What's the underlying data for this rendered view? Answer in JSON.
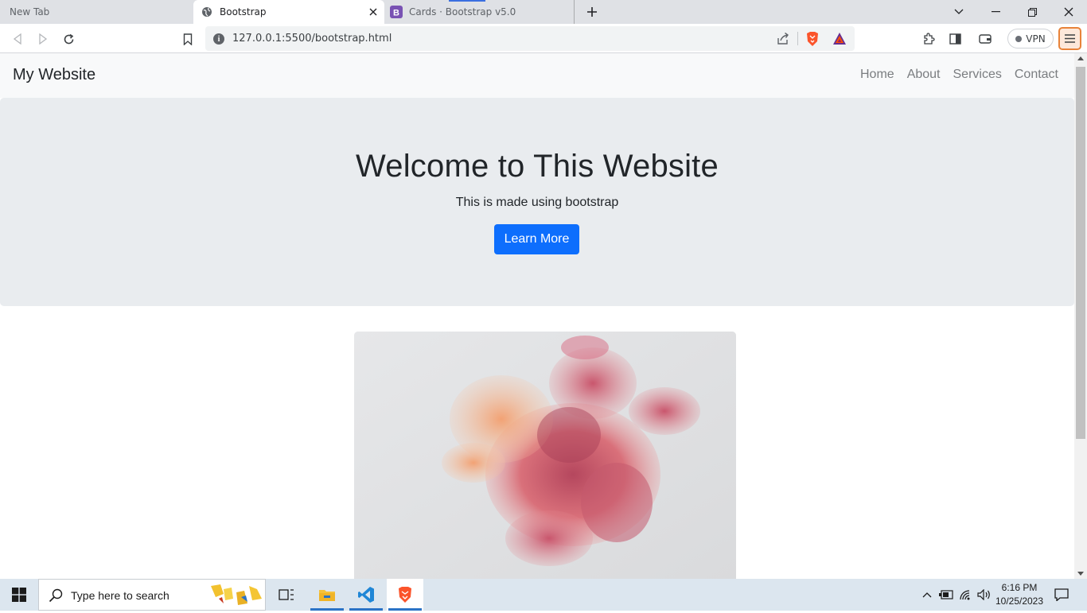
{
  "browser": {
    "tabs": [
      {
        "title": "New Tab",
        "state": "inactive"
      },
      {
        "title": "Bootstrap",
        "state": "active"
      },
      {
        "title": "Cards · Bootstrap v5.0",
        "state": "inactive"
      }
    ],
    "url": "127.0.0.1:5500/bootstrap.html",
    "vpn_label": "VPN",
    "accent_color": "#0d6efd"
  },
  "page": {
    "brand": "My Website",
    "nav": [
      {
        "label": "Home"
      },
      {
        "label": "About"
      },
      {
        "label": "Services"
      },
      {
        "label": "Contact"
      }
    ],
    "hero": {
      "heading": "Welcome to This Website",
      "subtext": "This is made using bootstrap",
      "button_label": "Learn More"
    }
  },
  "taskbar": {
    "search_placeholder": "Type here to search",
    "time": "6:16 PM",
    "date": "10/25/2023"
  }
}
